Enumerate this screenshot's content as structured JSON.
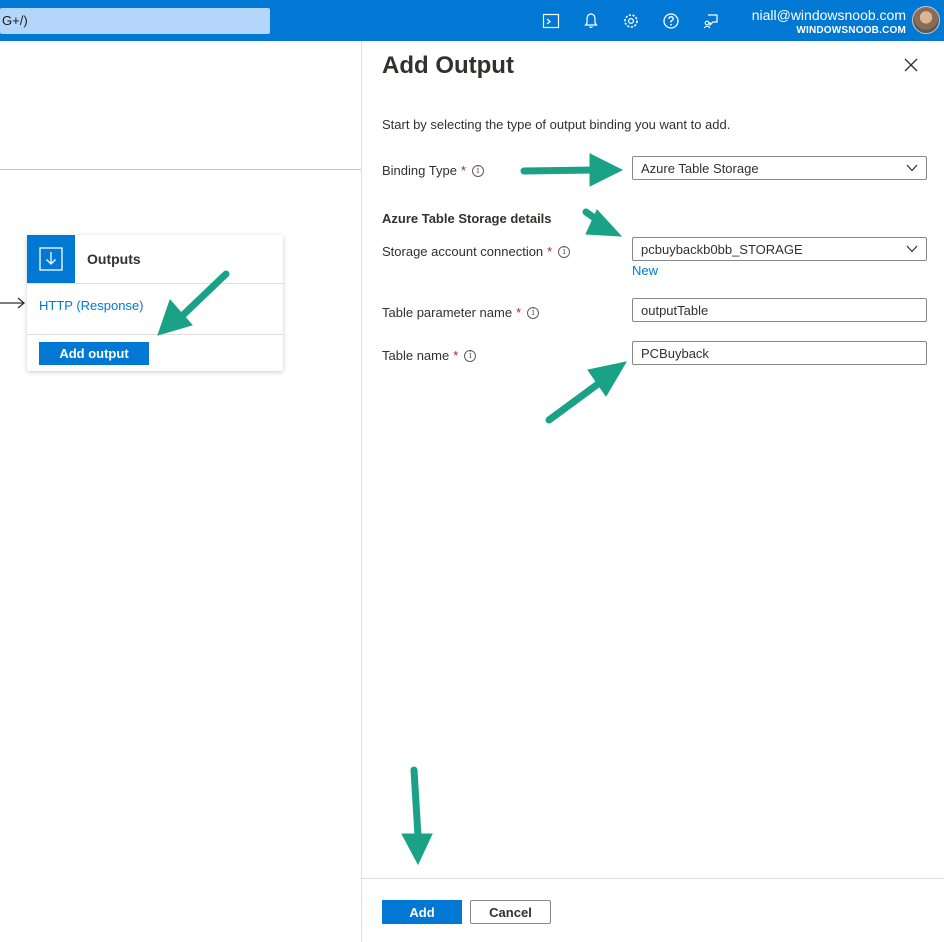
{
  "header": {
    "search_text": "G+/)",
    "user_name": "niall@windowsnoob.com",
    "user_tenant": "WINDOWSNOOB.COM",
    "icons": [
      "cloud-shell-icon",
      "notifications-icon",
      "settings-icon",
      "help-icon",
      "feedback-icon"
    ]
  },
  "outputs_card": {
    "title": "Outputs",
    "link": "HTTP (Response)",
    "button": "Add output"
  },
  "panel": {
    "title": "Add Output",
    "intro": "Start by selecting the type of output binding you want to add.",
    "binding_type": {
      "label": "Binding Type",
      "required": "*",
      "value": "Azure Table Storage"
    },
    "section_heading": "Azure Table Storage details",
    "storage_connection": {
      "label": "Storage account connection",
      "required": "*",
      "value": "pcbuybackb0bb_STORAGE",
      "new_link": "New"
    },
    "table_param": {
      "label": "Table parameter name",
      "required": "*",
      "value": "outputTable"
    },
    "table_name": {
      "label": "Table name",
      "required": "*",
      "value": "PCBuyback"
    },
    "add_button": "Add",
    "cancel_button": "Cancel"
  },
  "colors": {
    "accent": "#0078d4",
    "annotation_arrow": "#1aa287"
  }
}
